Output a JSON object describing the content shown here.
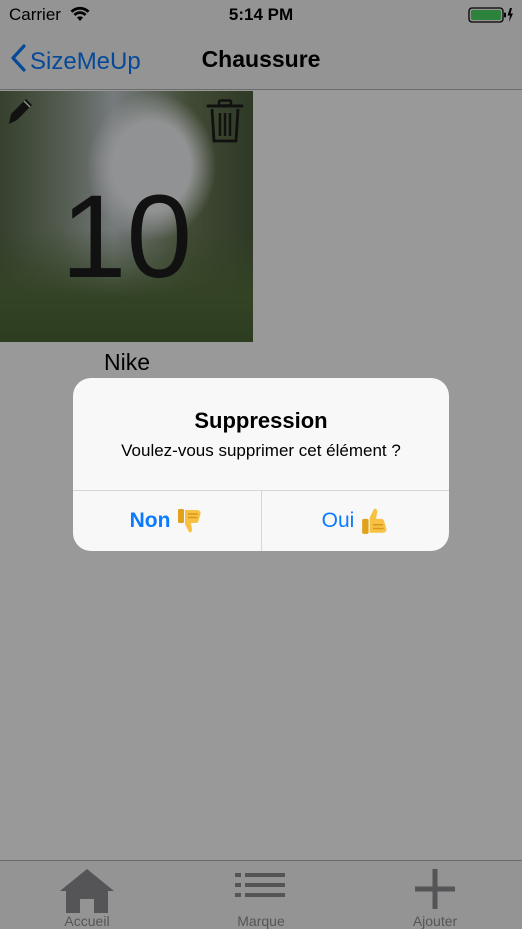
{
  "status_bar": {
    "carrier": "Carrier",
    "time": "5:14 PM",
    "wifi_icon": "wifi-icon",
    "battery_icon": "battery-icon",
    "battery_color": "#4cd964"
  },
  "nav": {
    "back_label": "SizeMeUp",
    "title": "Chaussure"
  },
  "item": {
    "size": "10",
    "brand": "Nike",
    "edit_icon": "pencil-icon",
    "delete_icon": "trash-icon"
  },
  "tab_bar": {
    "tabs": [
      {
        "label": "Accueil",
        "icon": "house-icon"
      },
      {
        "label": "Marque",
        "icon": "list-icon"
      },
      {
        "label": "Ajouter",
        "icon": "plus-icon"
      }
    ]
  },
  "alert": {
    "title": "Suppression",
    "message": "Voulez-vous supprimer cet élément ?",
    "cancel_label": "Non",
    "cancel_icon": "thumbs-down-icon",
    "confirm_label": "Oui",
    "confirm_icon": "thumbs-up-icon"
  },
  "colors": {
    "accent": "#0a7aff",
    "overlay": "rgba(0,0,0,0.4)",
    "tab_inactive": "#8e8e93"
  }
}
